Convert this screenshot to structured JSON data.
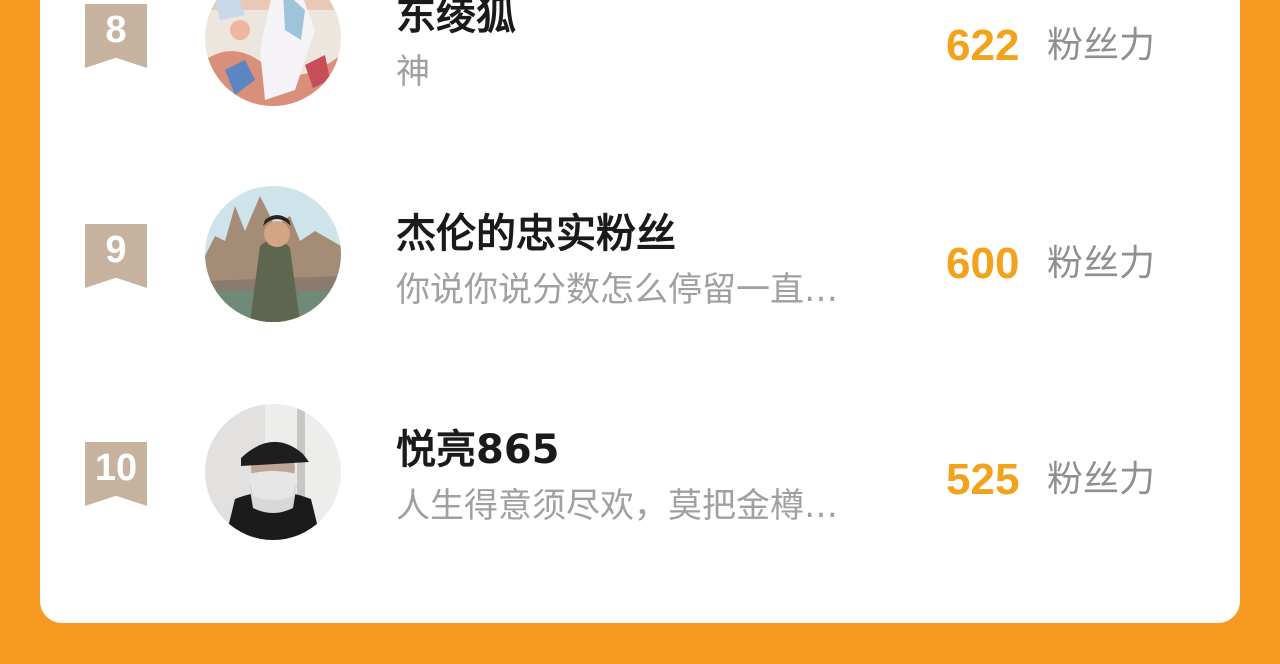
{
  "theme": {
    "background": "#F79A22",
    "card": "#FFFFFF",
    "rank_badge": "#C7B29F",
    "score_color": "#F3A21C",
    "bio_color": "#A0A0A0",
    "unit_color": "#8F8F8F"
  },
  "leaderboard": {
    "unit_label": "粉丝力",
    "rows": [
      {
        "rank": "8",
        "name": "东绫狐",
        "bio": "神",
        "score": "622",
        "avatar": "illustration-avatar"
      },
      {
        "rank": "9",
        "name": "杰伦的忠实粉丝",
        "bio": "你说你说分数怎么停留一直…",
        "score": "600",
        "avatar": "photo-avatar-castle"
      },
      {
        "rank": "10",
        "name": "悦亮865",
        "bio": "人生得意须尽欢，莫把金樽…",
        "score": "525",
        "avatar": "photo-avatar-cap"
      }
    ]
  }
}
